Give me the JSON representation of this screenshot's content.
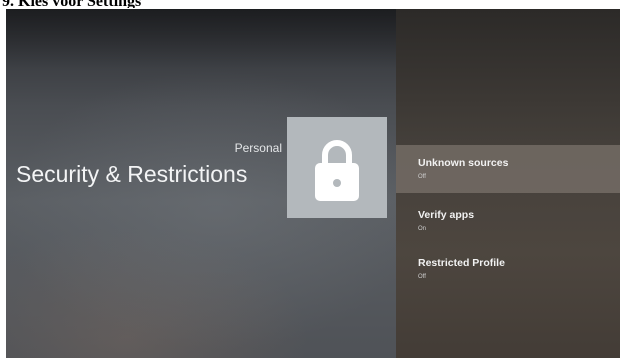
{
  "document": {
    "caption": "9.   Kies voor Settings"
  },
  "header": {
    "section": "Personal",
    "title": "Security & Restrictions"
  },
  "icon": {
    "name": "lock-icon",
    "tile_color": "#b3b8bc",
    "glyph_color": "#ffffff"
  },
  "settings": {
    "items": [
      {
        "title": "Unknown sources",
        "value": "Off",
        "focused": true
      },
      {
        "title": "Verify apps",
        "value": "On",
        "focused": false
      },
      {
        "title": "Restricted Profile",
        "value": "Off",
        "focused": false
      }
    ]
  }
}
